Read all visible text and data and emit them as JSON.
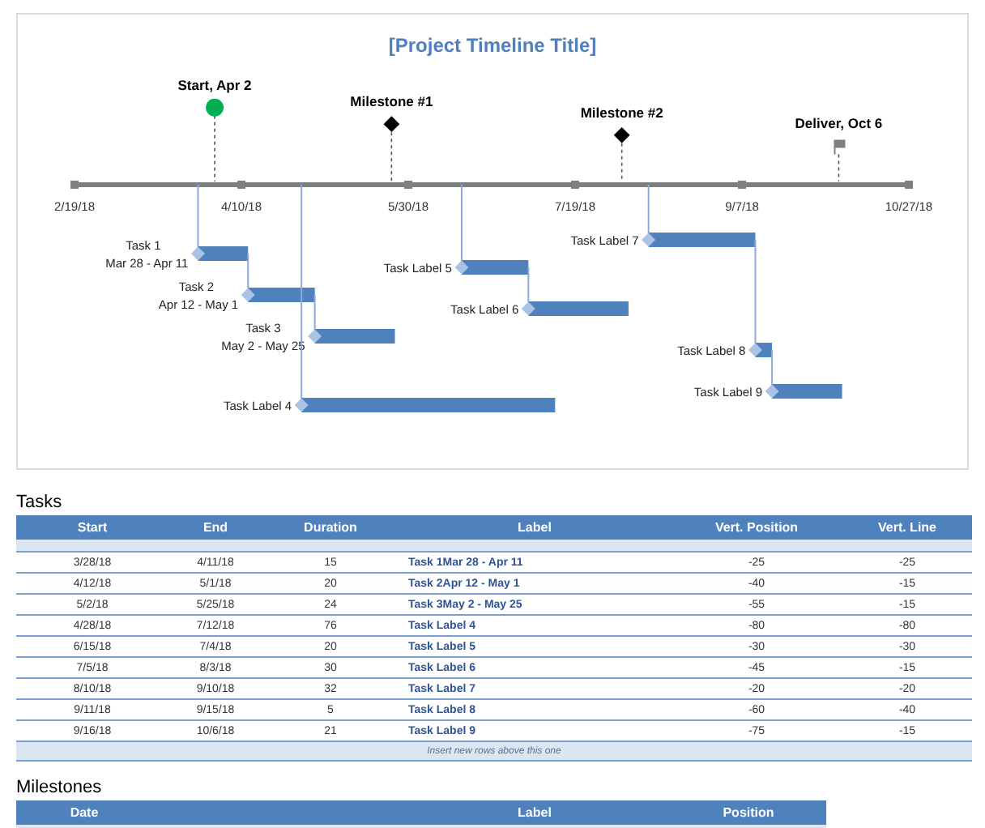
{
  "timeline": {
    "title": "[Project Timeline Title]",
    "axis_labels": [
      "2/19/18",
      "4/10/18",
      "5/30/18",
      "7/19/18",
      "9/7/18",
      "10/27/18"
    ],
    "milestones": [
      {
        "label": "Start, Apr 2",
        "kind": "circle"
      },
      {
        "label": "Milestone #1",
        "kind": "diamond"
      },
      {
        "label": "Milestone #2",
        "kind": "diamond"
      },
      {
        "label": "Deliver, Oct 6",
        "kind": "flag"
      }
    ],
    "tasks": [
      {
        "lines": [
          "Task 1",
          "Mar 28 - Apr 11"
        ]
      },
      {
        "lines": [
          "Task 2",
          "Apr 12 - May 1"
        ]
      },
      {
        "lines": [
          "Task 3",
          "May 2 - May 25"
        ]
      },
      {
        "lines": [
          "Task Label 4"
        ]
      },
      {
        "lines": [
          "Task Label 5"
        ]
      },
      {
        "lines": [
          "Task Label 6"
        ]
      },
      {
        "lines": [
          "Task Label 7"
        ]
      },
      {
        "lines": [
          "Task Label 8"
        ]
      },
      {
        "lines": [
          "Task Label 9"
        ]
      }
    ]
  },
  "tasks": {
    "title": "Tasks",
    "columns": [
      "Start",
      "End",
      "Duration",
      "Label",
      "Vert. Position",
      "Vert. Line"
    ],
    "rows": [
      [
        "3/28/18",
        "4/11/18",
        "15",
        "Task 1Mar 28 - Apr 11",
        "-25",
        "-25"
      ],
      [
        "4/12/18",
        "5/1/18",
        "20",
        "Task 2Apr 12 - May 1",
        "-40",
        "-15"
      ],
      [
        "5/2/18",
        "5/25/18",
        "24",
        "Task 3May 2 - May 25",
        "-55",
        "-15"
      ],
      [
        "4/28/18",
        "7/12/18",
        "76",
        "Task Label 4",
        "-80",
        "-80"
      ],
      [
        "6/15/18",
        "7/4/18",
        "20",
        "Task Label 5",
        "-30",
        "-30"
      ],
      [
        "7/5/18",
        "8/3/18",
        "30",
        "Task Label 6",
        "-45",
        "-15"
      ],
      [
        "8/10/18",
        "9/10/18",
        "32",
        "Task Label 7",
        "-20",
        "-20"
      ],
      [
        "9/11/18",
        "9/15/18",
        "5",
        "Task Label 8",
        "-60",
        "-40"
      ],
      [
        "9/16/18",
        "10/6/18",
        "21",
        "Task Label 9",
        "-75",
        "-15"
      ]
    ],
    "footer": "Insert new rows above this one"
  },
  "milestones": {
    "title": "Milestones",
    "columns": [
      "Date",
      "Label",
      "Position"
    ]
  }
}
